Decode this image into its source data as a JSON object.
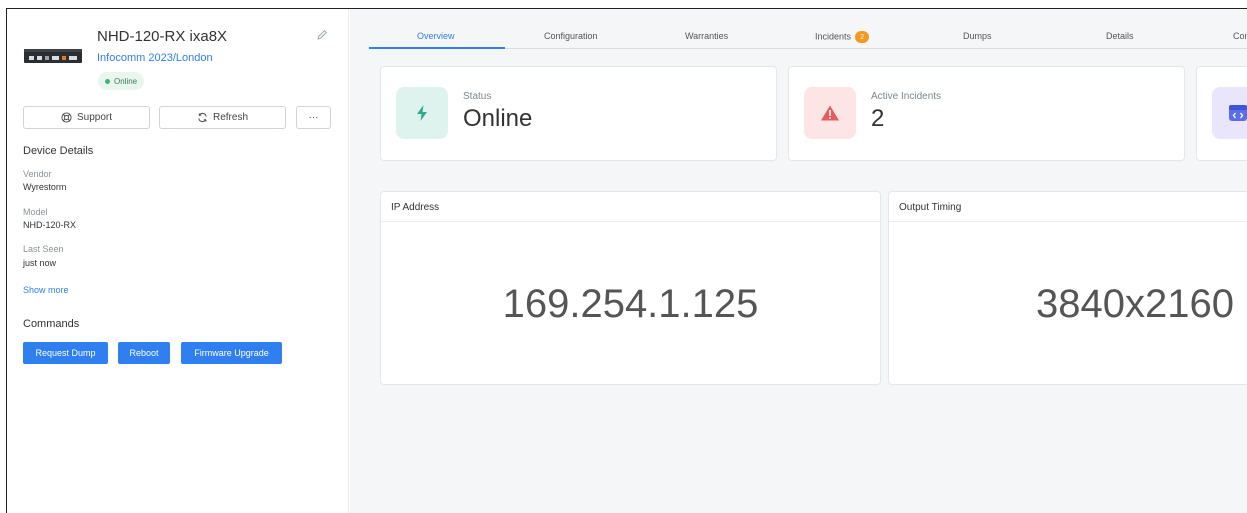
{
  "device": {
    "title": "NHD-120-RX ixa8X",
    "location_link": "Infocomm 2023/London",
    "status_badge": "Online",
    "image_icon": "av-receiver-device-image",
    "edit_icon": "pencil-icon"
  },
  "actions": {
    "support_label": "Support",
    "support_icon": "lifebuoy-icon",
    "refresh_label": "Refresh",
    "refresh_icon": "refresh-icon",
    "more_label": "···"
  },
  "details": {
    "section_title": "Device Details",
    "fields": [
      {
        "label": "Vendor",
        "value": "Wyrestorm"
      },
      {
        "label": "Model",
        "value": "NHD-120-RX"
      },
      {
        "label": "Last Seen",
        "value": "just now"
      }
    ],
    "show_more": "Show more"
  },
  "commands": {
    "section_title": "Commands",
    "buttons": [
      "Request Dump",
      "Reboot",
      "Firmware Upgrade"
    ]
  },
  "tabs": [
    {
      "label": "Overview",
      "active": true
    },
    {
      "label": "Configuration"
    },
    {
      "label": "Warranties"
    },
    {
      "label": "Incidents",
      "badge": "2"
    },
    {
      "label": "Dumps"
    },
    {
      "label": "Details"
    },
    {
      "label": "Comm"
    }
  ],
  "summary_cards": [
    {
      "label": "Status",
      "value": "Online",
      "icon": "bolt-icon",
      "color": "#2fa98c"
    },
    {
      "label": "Active Incidents",
      "value": "2",
      "icon": "warning-triangle-icon",
      "color": "#e35d5d"
    },
    {
      "label": "",
      "value": "",
      "icon": "code-window-icon",
      "color": "#5b6ee8"
    }
  ],
  "panels": {
    "ip": {
      "title": "IP Address",
      "value": "169.254.1.125"
    },
    "timing": {
      "title": "Output Timing",
      "value": "3840x2160"
    }
  },
  "colors": {
    "accent": "#2f7ff0",
    "online_dot": "#3fb37a",
    "incident_badge": "#f39a1e"
  }
}
